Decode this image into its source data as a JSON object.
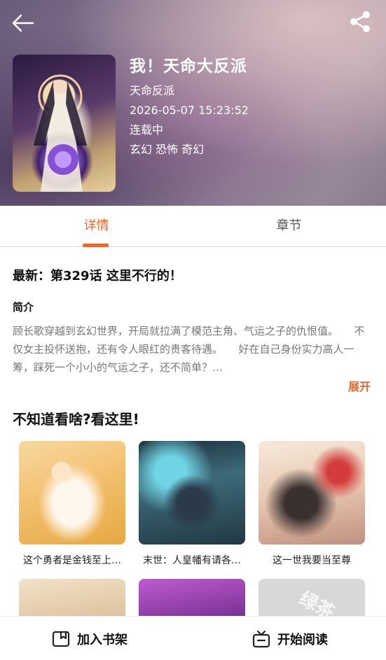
{
  "header": {
    "title": "我！天命大反派",
    "author": "天命反派",
    "updated": "2026-05-07 15:23:52",
    "status": "连载中",
    "genres": "玄幻 恐怖 奇幻",
    "back_icon": "arrow-left-icon",
    "share_icon": "share-icon"
  },
  "tabs": [
    {
      "label": "详情",
      "active": true
    },
    {
      "label": "章节",
      "active": false
    }
  ],
  "detail": {
    "latest": "最新：第329话 这里不行的！",
    "intro_label": "简介",
    "intro_text": "顾长歌穿越到玄幻世界，开局就拉满了模范主角、气运之子的仇恨值。　　不仅女主投怀送抱，还有令人眼红的贵客待遇。　　好在自己身份实力高人一筹，踩死一个小小的气运之子，还不简单？…",
    "expand": "展开"
  },
  "recommend": {
    "title": "不知道看啥?看这里!",
    "items": [
      {
        "caption": "这个勇者是金钱至上…"
      },
      {
        "caption": "末世：人皇幡有请各…"
      },
      {
        "caption": "这一世我要当至尊"
      },
      {
        "caption": ""
      },
      {
        "caption": ""
      },
      {
        "caption": "",
        "watermark": "绿茶"
      }
    ]
  },
  "bottom": {
    "add_shelf": "加入书架",
    "start_read": "开始阅读"
  },
  "colors": {
    "accent": "#e9662d"
  }
}
